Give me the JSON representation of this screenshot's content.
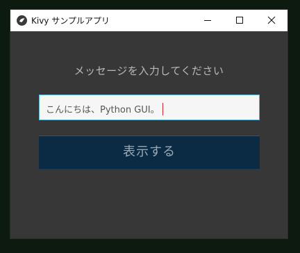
{
  "window": {
    "title": "Kivy サンプルアプリ",
    "app_icon": "kivy-logo-icon",
    "controls": {
      "minimize_icon": "minimize-icon",
      "maximize_icon": "maximize-icon",
      "close_icon": "close-icon"
    }
  },
  "main": {
    "prompt": "メッセージを入力してください",
    "input": {
      "value": "こんにちは、Python GUI。"
    },
    "button_label": "表示する"
  },
  "colors": {
    "window_background": "#373737",
    "titlebar": "#ffffff",
    "input_border": "#5cb6d6",
    "caret": "#c1272d",
    "button_background": "#0b2a44",
    "button_text": "#9aa9b6",
    "prompt_text": "#b9b9b9"
  }
}
